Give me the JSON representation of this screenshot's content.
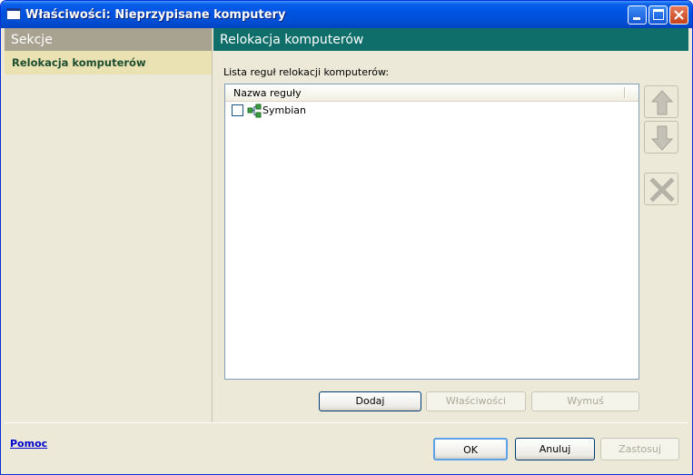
{
  "window": {
    "title": "Właściwości: Nieprzypisane komputery"
  },
  "sidebar": {
    "header": "Sekcje",
    "items": [
      {
        "label": "Relokacja komputerów",
        "selected": true
      }
    ]
  },
  "main": {
    "header": "Relokacja komputerów",
    "list_label": "Lista reguł relokacji komputerów:",
    "list": {
      "column_header": "Nazwa reguły",
      "rows": [
        {
          "label": "Symbian",
          "checked": false,
          "icon": "network-icon"
        }
      ]
    },
    "buttons": {
      "add": "Dodaj",
      "properties": "Właściwości",
      "force": "Wymuś"
    }
  },
  "footer": {
    "help": "Pomoc",
    "ok": "OK",
    "cancel": "Anuluj",
    "apply": "Zastosuj"
  },
  "colors": {
    "title_bar": "#0054e3",
    "main_header": "#0f6e6a",
    "sidebar_header": "#a8a290",
    "selected_item": "#ebe2b4"
  }
}
